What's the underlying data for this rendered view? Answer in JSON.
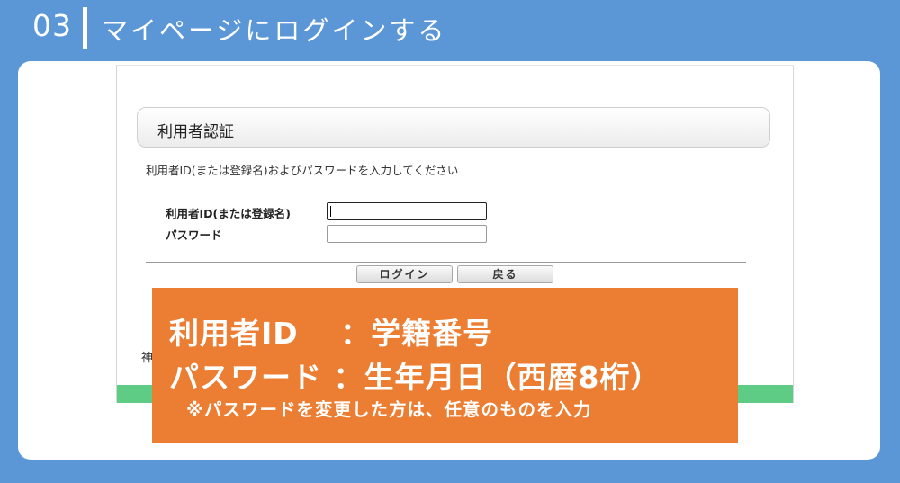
{
  "header": {
    "step_number": "03",
    "title": "マイページにログインする"
  },
  "login_screen": {
    "heading": "利用者認証",
    "instruction": "利用者ID(または登録名)およびパスワードを入力してください",
    "user_id_label": "利用者ID(または登録名)",
    "password_label": "パスワード",
    "user_id_value": "",
    "password_value": "",
    "login_button": "ログイン",
    "back_button": "戻る",
    "footer_text": "神"
  },
  "callout": {
    "line1": "利用者ID　 ：学籍番号",
    "line2": "パスワード ：生年月日（西暦8桁）",
    "note": "※パスワードを変更した方は、任意のものを入力"
  },
  "colors": {
    "background": "#5b97d6",
    "callout": "#ec7e33",
    "footer_strip": "#5fcc86"
  }
}
